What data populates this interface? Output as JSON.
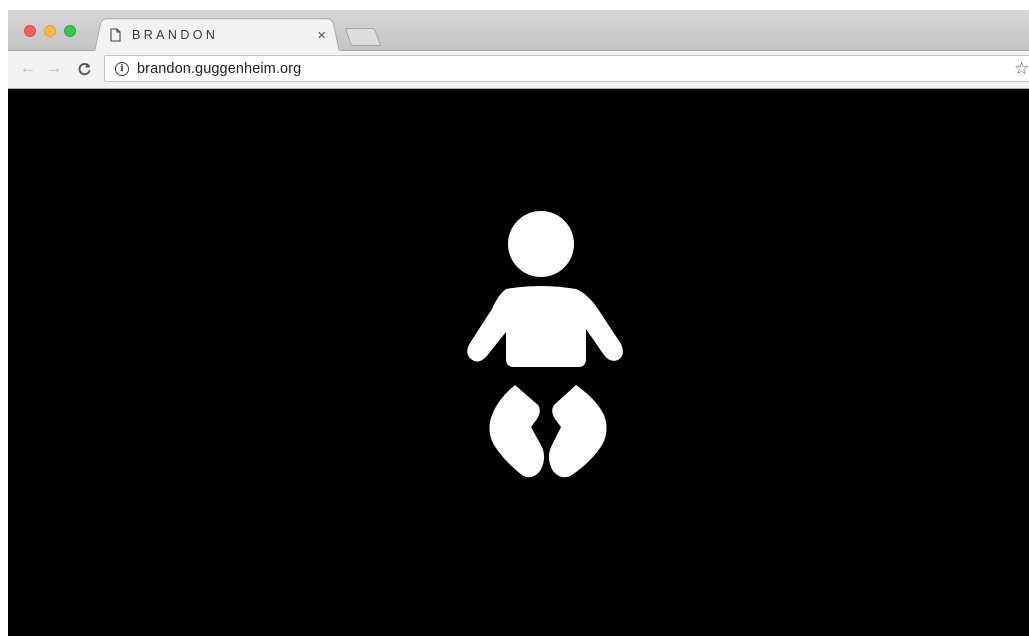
{
  "browser": {
    "tab": {
      "title": "BRANDON",
      "close_glyph": "×",
      "page_icon": "document-icon"
    },
    "nav": {
      "back_glyph": "←",
      "forward_glyph": "→",
      "reload_glyph": "C"
    },
    "address_bar": {
      "info_glyph": "i",
      "url": "brandon.guggenheim.org"
    },
    "bookmark_glyph": "☆"
  },
  "page": {
    "background": "#000000",
    "icon": "baby-icon",
    "icon_color": "#ffffff"
  }
}
